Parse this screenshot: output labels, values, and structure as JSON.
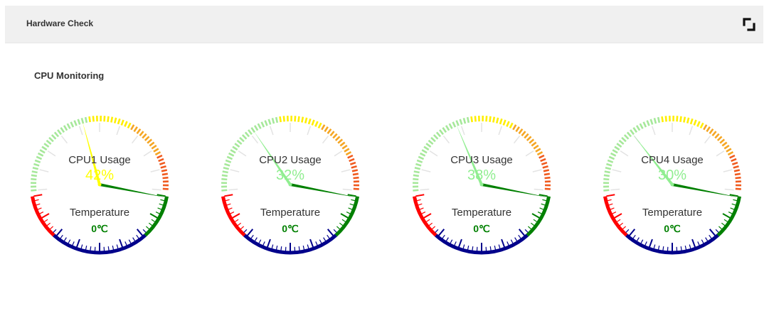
{
  "header": {
    "title": "Hardware Check",
    "expand_icon": "expand-icon"
  },
  "section": {
    "title": "CPU Monitoring"
  },
  "colors": {
    "header_bg": "#f0f0f0",
    "usage_arc_low": "#a6e89a",
    "usage_arc_mid": "#ffef00",
    "usage_arc_high": "#f5a623",
    "usage_arc_max": "#f05a1e",
    "temp_arc_cold": "#ff0000",
    "temp_arc_normal": "#00008b",
    "temp_arc_hot": "#008000"
  },
  "gauges": [
    {
      "usage_label": "CPU1  Usage",
      "usage_value": "42%",
      "usage_percent": 42,
      "usage_color": "#ffff00",
      "temp_label": "Temperature",
      "temp_value": "0℃",
      "temp_color": "#008000"
    },
    {
      "usage_label": "CPU2  Usage",
      "usage_value": "32%",
      "usage_percent": 32,
      "usage_color": "#90ee90",
      "temp_label": "Temperature",
      "temp_value": "0℃",
      "temp_color": "#008000"
    },
    {
      "usage_label": "CPU3  Usage",
      "usage_value": "38%",
      "usage_percent": 38,
      "usage_color": "#90ee90",
      "temp_label": "Temperature",
      "temp_value": "0℃",
      "temp_color": "#008000"
    },
    {
      "usage_label": "CPU4  Usage",
      "usage_value": "30%",
      "usage_percent": 30,
      "usage_color": "#90ee90",
      "temp_label": "Temperature",
      "temp_value": "0℃",
      "temp_color": "#008000"
    }
  ]
}
